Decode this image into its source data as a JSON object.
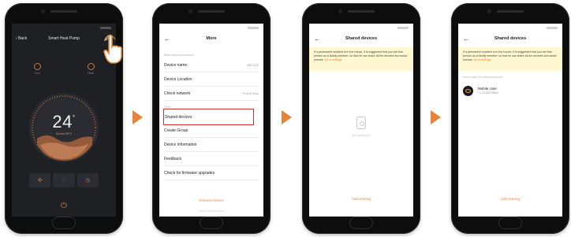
{
  "screen1": {
    "title": "Smart Heat Pump",
    "back_label": "Back",
    "modes": [
      {
        "label": "Cool"
      },
      {
        "label": "Heat"
      }
    ],
    "temperature": "24",
    "temperature_unit": "°",
    "temperature_sub": "Current 26°C",
    "controls": [
      "fan-icon",
      "mode-icon",
      "timer-icon"
    ],
    "power_icon": "power-icon",
    "accent": "#d8893f"
  },
  "screen2": {
    "title": "More",
    "caption1": "Basic device information",
    "rows": [
      {
        "label": "Device name",
        "value": "ABC123"
      },
      {
        "label": "Device Location",
        "value": ""
      },
      {
        "label": "Check network",
        "value": "Check Now"
      }
    ],
    "caption2": "Other",
    "rows2": [
      {
        "label": "Shared devices"
      },
      {
        "label": "Create Group"
      },
      {
        "label": "Device information"
      },
      {
        "label": "Feedback"
      },
      {
        "label": "Check for firmware upgrades"
      }
    ],
    "remove_label": "Remove Device",
    "bottom_hint": "Restore factory defaults"
  },
  "screen3": {
    "title": "Shared devices",
    "notice": "If a permanent resident is in the house, it is suggested that you set that person as a family member, so that he can share all the devices and smart scenes.",
    "notice_more": "Go to settings",
    "empty_text": "No sharing yet",
    "add_label": "Add sharing"
  },
  "screen4": {
    "title": "Shared devices",
    "notice": "If a permanent resident is in the house, it is suggested that you set that person as a family member, so that he can share all the devices and smart scenes.",
    "notice_more": "Go to settings",
    "caption": "Have shared the following accounts",
    "user_name": "Mobile User",
    "user_number": "+1-12-66278863",
    "add_label": "Add sharing"
  },
  "colors": {
    "accent": "#e8833a",
    "highlight": "#d0302a",
    "notice_bg": "#fff7cf"
  }
}
